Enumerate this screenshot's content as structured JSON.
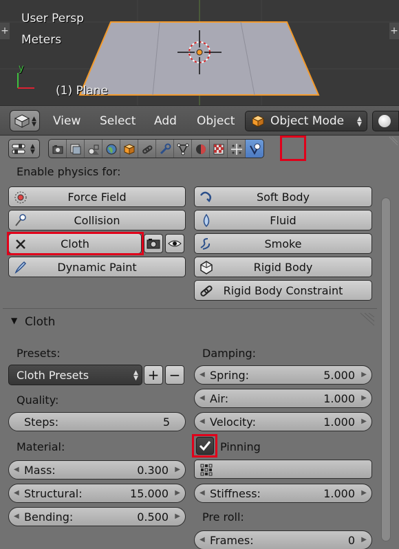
{
  "viewport": {
    "view_name": "User Persp",
    "units": "Meters",
    "object_label": "(1) Plane",
    "axis_y": "y"
  },
  "header": {
    "menus": [
      "View",
      "Select",
      "Add",
      "Object"
    ],
    "mode_label": "Object Mode"
  },
  "properties": {
    "active_tab": "physics-tab",
    "enable_physics_label": "Enable physics for:",
    "physics_buttons": {
      "force_field": "Force Field",
      "soft_body": "Soft Body",
      "collision": "Collision",
      "fluid": "Fluid",
      "cloth": "Cloth",
      "smoke": "Smoke",
      "dynamic_paint": "Dynamic Paint",
      "rigid_body": "Rigid Body",
      "rigid_body_constraint": "Rigid Body Constraint"
    },
    "cloth_panel": {
      "title": "Cloth",
      "presets_label": "Presets:",
      "presets_value": "Cloth Presets",
      "quality_label": "Quality:",
      "steps": {
        "label": "Steps:",
        "value": "5"
      },
      "material_label": "Material:",
      "mass": {
        "label": "Mass:",
        "value": "0.300"
      },
      "structural": {
        "label": "Structural:",
        "value": "15.000"
      },
      "bending": {
        "label": "Bending:",
        "value": "0.500"
      },
      "damping_label": "Damping:",
      "spring": {
        "label": "Spring:",
        "value": "5.000"
      },
      "air": {
        "label": "Air:",
        "value": "1.000"
      },
      "velocity": {
        "label": "Velocity:",
        "value": "1.000"
      },
      "pinning_label": "Pinning",
      "pinning_checked": true,
      "stiffness": {
        "label": "Stiffness:",
        "value": "1.000"
      },
      "preroll_label": "Pre roll:",
      "frames": {
        "label": "Frames:",
        "value": "0"
      }
    }
  },
  "colors": {
    "highlight": "#e0001a",
    "active_tab": "#4a78c0",
    "selection_orange": "#f39a2b"
  }
}
